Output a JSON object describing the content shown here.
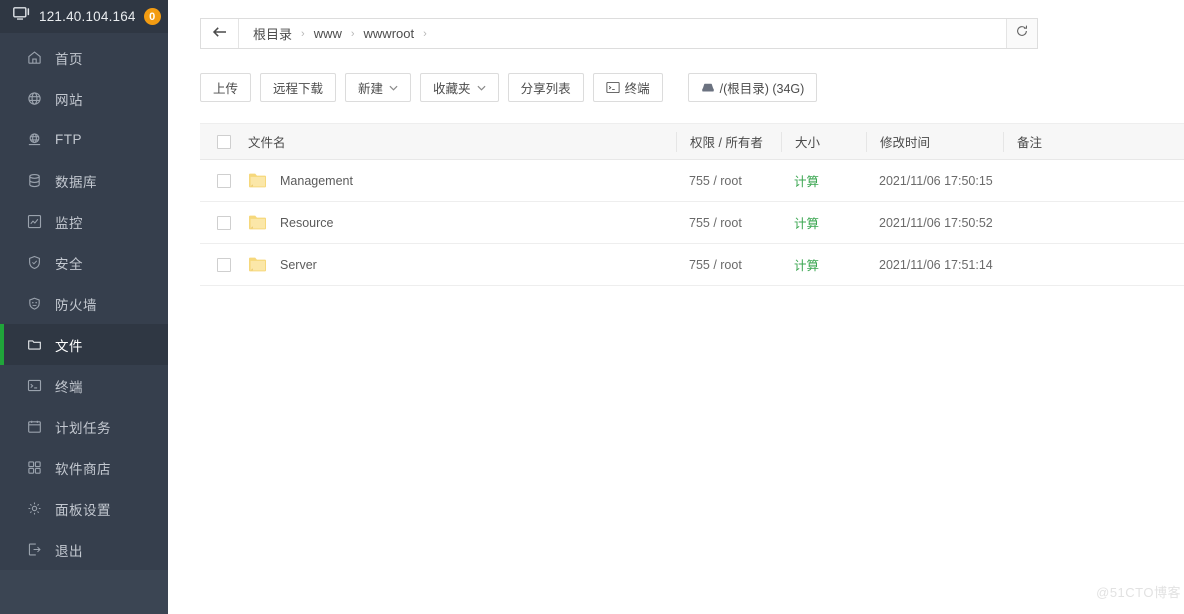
{
  "sidebar": {
    "header": {
      "ip": "121.40.104.164",
      "badge": "0",
      "icon": "monitor-icon"
    },
    "items": [
      {
        "label": "首页",
        "icon": "home-icon",
        "active": false
      },
      {
        "label": "网站",
        "icon": "globe-icon",
        "active": false
      },
      {
        "label": "FTP",
        "icon": "ftp-globe-icon",
        "active": false
      },
      {
        "label": "数据库",
        "icon": "database-icon",
        "active": false
      },
      {
        "label": "监控",
        "icon": "chart-icon",
        "active": false
      },
      {
        "label": "安全",
        "icon": "shield-icon",
        "active": false
      },
      {
        "label": "防火墙",
        "icon": "firewall-icon",
        "active": false
      },
      {
        "label": "文件",
        "icon": "folder-icon",
        "active": true
      },
      {
        "label": "终端",
        "icon": "terminal-icon",
        "active": false
      },
      {
        "label": "计划任务",
        "icon": "calendar-icon",
        "active": false
      },
      {
        "label": "软件商店",
        "icon": "grid-icon",
        "active": false
      },
      {
        "label": "面板设置",
        "icon": "gear-icon",
        "active": false
      },
      {
        "label": "退出",
        "icon": "logout-icon",
        "active": false
      }
    ],
    "active_accent": "#20a53a"
  },
  "breadcrumb": {
    "back_icon": "arrow-left-icon",
    "refresh_icon": "refresh-icon",
    "segments": [
      "根目录",
      "www",
      "wwwroot"
    ],
    "separator": "›"
  },
  "toolbar": {
    "buttons": [
      {
        "label": "上传",
        "icon": null,
        "caret": false
      },
      {
        "label": "远程下载",
        "icon": null,
        "caret": false
      },
      {
        "label": "新建",
        "icon": null,
        "caret": true
      },
      {
        "label": "收藏夹",
        "icon": null,
        "caret": true
      },
      {
        "label": "分享列表",
        "icon": null,
        "caret": false
      },
      {
        "label": "终端",
        "icon": "terminal-icon",
        "caret": false
      }
    ],
    "disk": {
      "label": "/(根目录) (34G)",
      "icon": "disk-icon"
    }
  },
  "table": {
    "headers": [
      "文件名",
      "权限 / 所有者",
      "大小",
      "修改时间",
      "备注"
    ],
    "rows": [
      {
        "name": "Management",
        "perm": "755 / root",
        "size": "计算",
        "time": "2021/11/06 17:50:15",
        "note": "",
        "icon": "folder-icon"
      },
      {
        "name": "Resource",
        "perm": "755 / root",
        "size": "计算",
        "time": "2021/11/06 17:50:52",
        "note": "",
        "icon": "folder-icon"
      },
      {
        "name": "Server",
        "perm": "755 / root",
        "size": "计算",
        "time": "2021/11/06 17:51:14",
        "note": "",
        "icon": "folder-icon"
      }
    ],
    "size_link_color": "#3aa650"
  },
  "watermark": "@51CTO博客"
}
